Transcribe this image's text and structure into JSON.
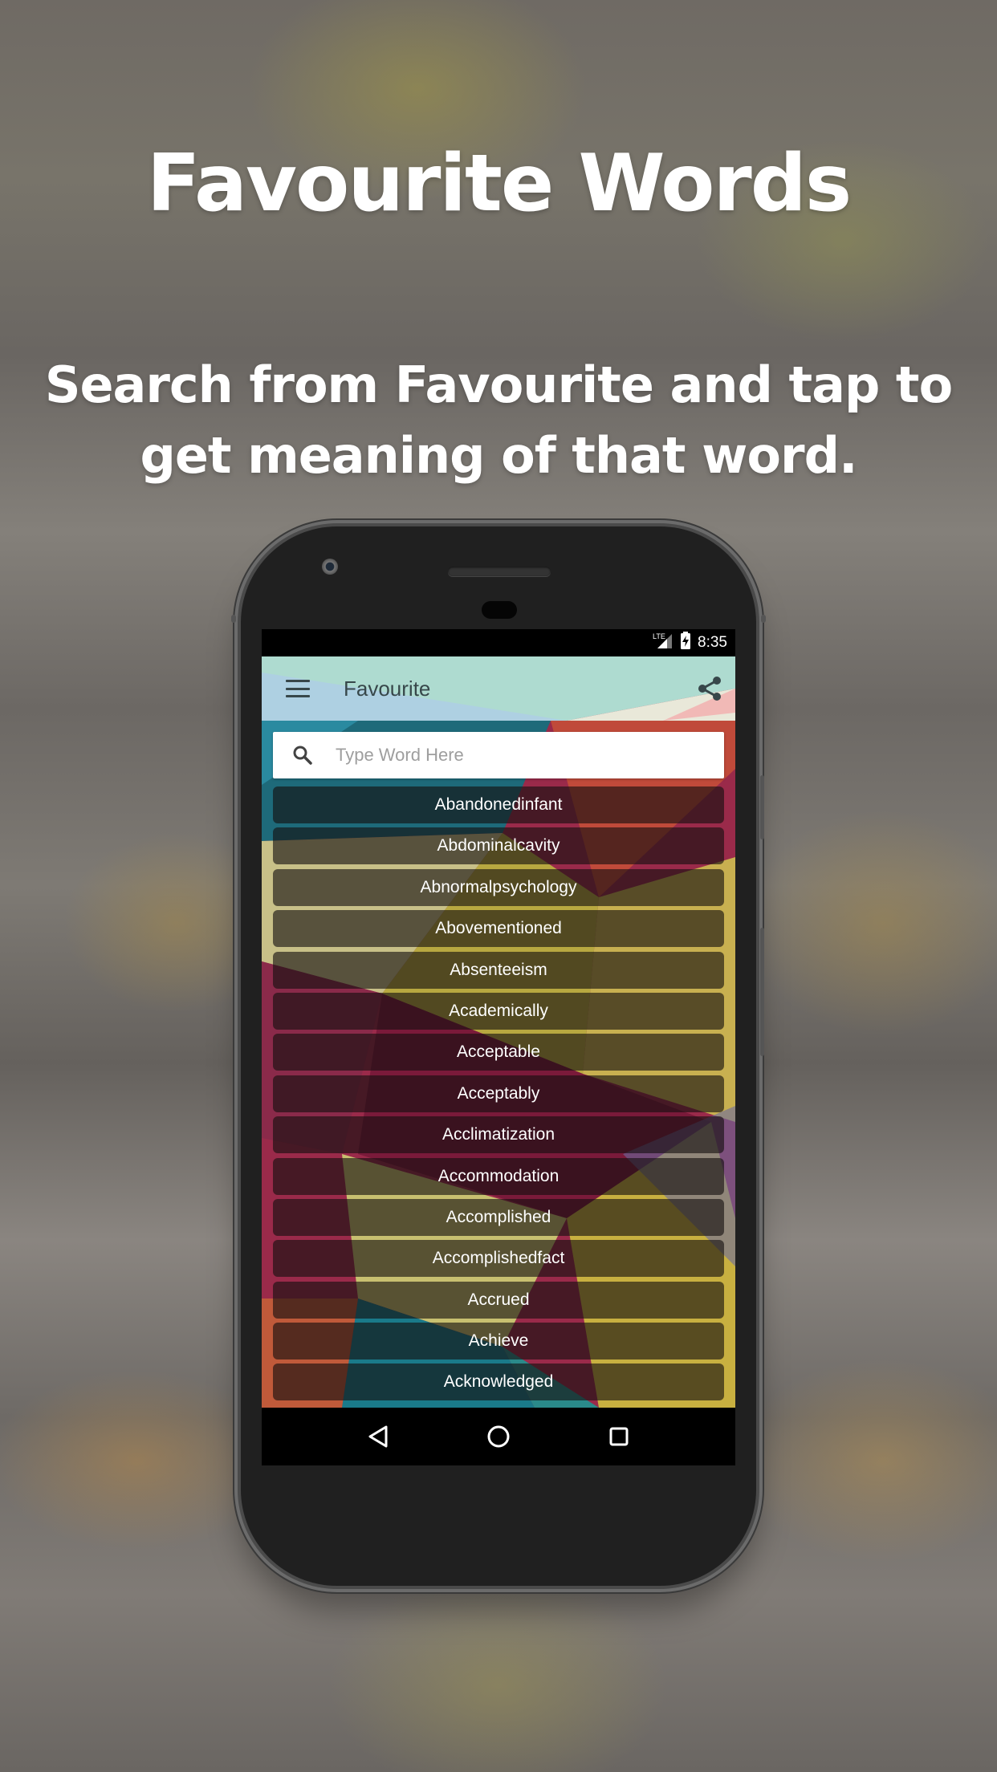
{
  "promo": {
    "headline": "Favourite Words",
    "subline": "Search from Favourite and tap to get meaning of that word."
  },
  "status_bar": {
    "network": "LTE",
    "signal_icon": "cell-signal-icon",
    "battery_icon": "battery-charging-icon",
    "time": "8:35"
  },
  "toolbar": {
    "menu_icon": "hamburger-menu-icon",
    "title": "Favourite",
    "share_icon": "share-icon"
  },
  "search": {
    "icon": "search-icon",
    "placeholder": "Type Word Here",
    "value": ""
  },
  "words": [
    "Abandonedinfant",
    "Abdominalcavity",
    "Abnormalpsychology",
    "Abovementioned",
    "Absenteeism",
    "Academically",
    "Acceptable",
    "Acceptably",
    "Acclimatization",
    "Accommodation",
    "Accomplished",
    "Accomplishedfact",
    "Accrued",
    "Achieve",
    "Acknowledged"
  ],
  "nav_bar": {
    "back_icon": "back-triangle-icon",
    "home_icon": "home-circle-icon",
    "recents_icon": "recents-square-icon"
  },
  "colors": {
    "toolbar_text": "#37474a",
    "list_item_bg": "#140f0f",
    "placeholder": "#9e9e9e"
  }
}
